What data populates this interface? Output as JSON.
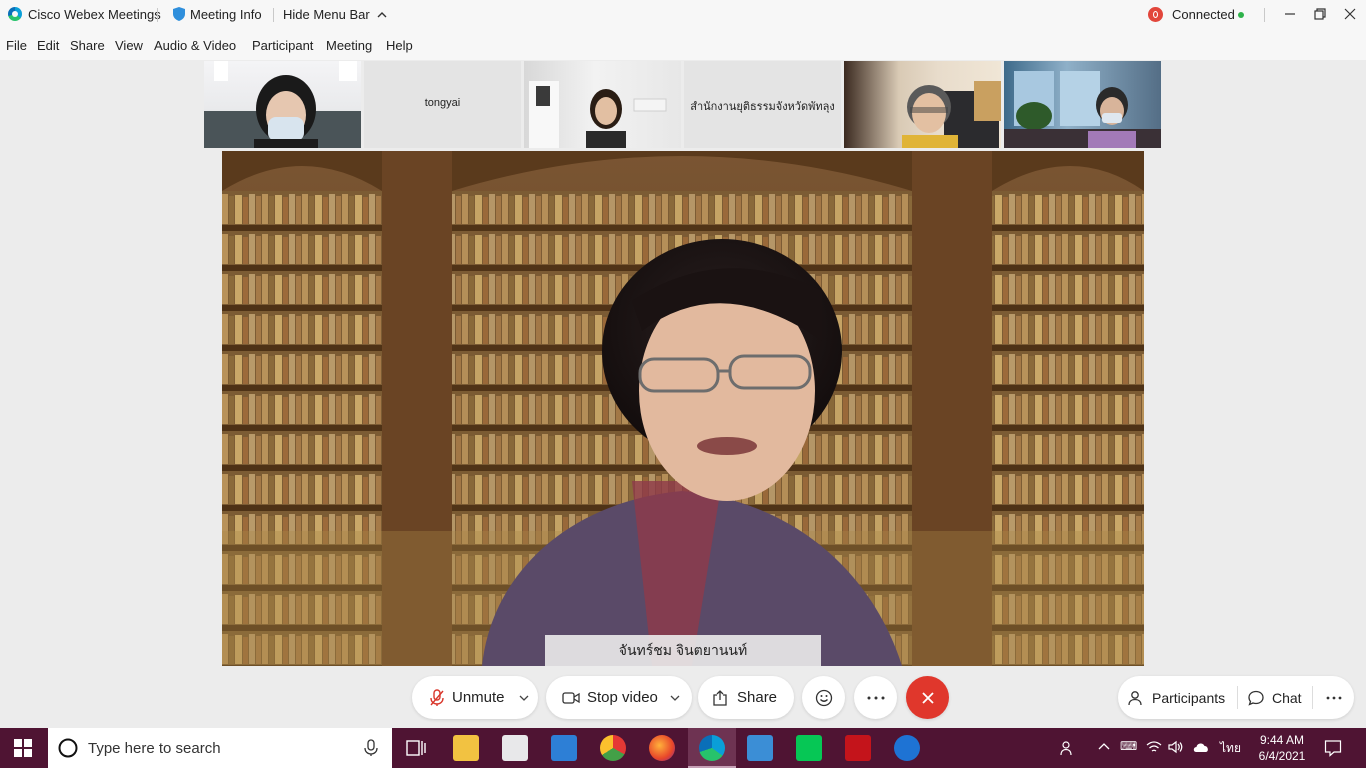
{
  "titlebar": {
    "app_name": "Cisco Webex Meetings",
    "meeting_info": "Meeting Info",
    "hide_menu": "Hide Menu Bar",
    "status": "Connected"
  },
  "menu": [
    "File",
    "Edit",
    "Share",
    "View",
    "Audio & Video",
    "Participant",
    "Meeting",
    "Help"
  ],
  "filmstrip": {
    "names": [
      "tongyai",
      "สำนักงานยุติธรรมจังหวัดพัทลุง"
    ]
  },
  "active_speaker": "จันทร์ชม จินตยานนท์",
  "controls": {
    "unmute": "Unmute",
    "stop_video": "Stop video",
    "share": "Share",
    "participants": "Participants",
    "chat": "Chat"
  },
  "taskbar": {
    "search_placeholder": "Type here to search",
    "language": "ไทย",
    "time": "9:44 AM",
    "date": "6/4/2021"
  },
  "colors": {
    "end_call": "#e0372c",
    "taskbar": "#4f1433",
    "connected": "#2eb24a"
  }
}
